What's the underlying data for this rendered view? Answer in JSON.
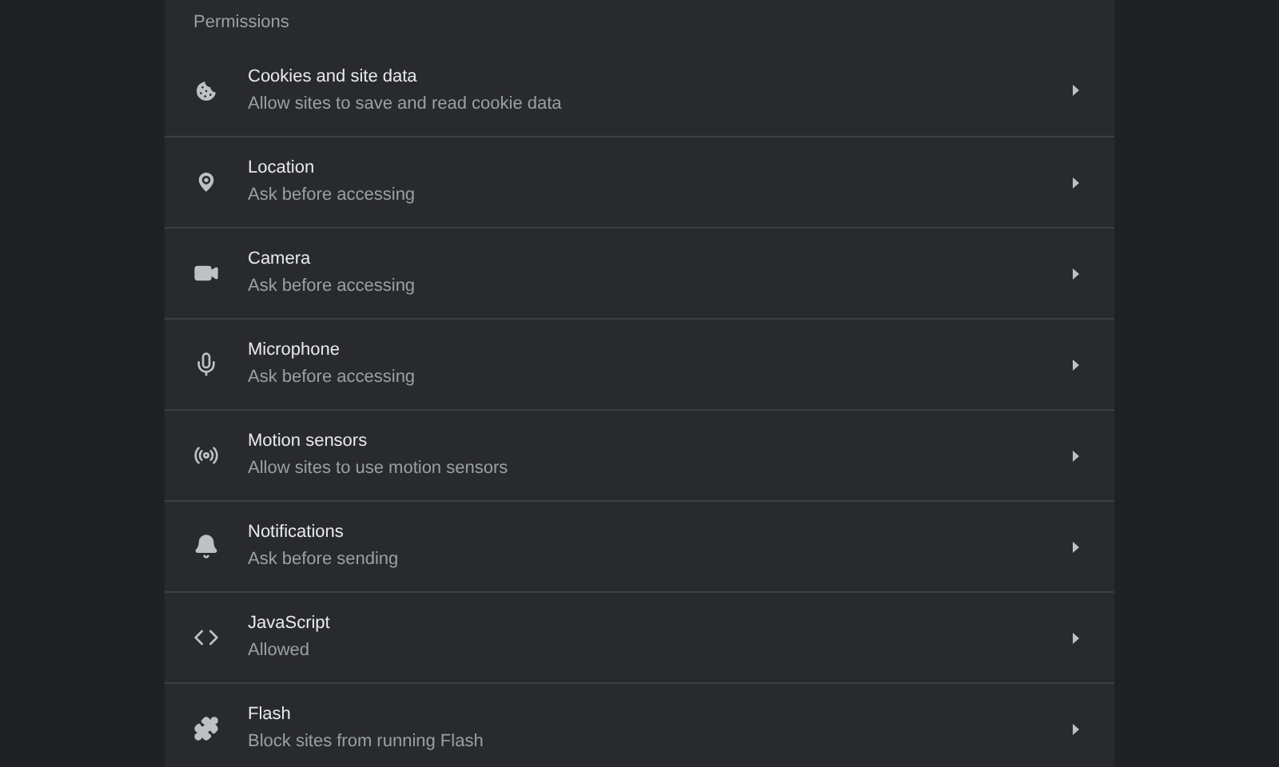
{
  "section_title": "Permissions",
  "items": [
    {
      "title": "Cookies and site data",
      "subtitle": "Allow sites to save and read cookie data"
    },
    {
      "title": "Location",
      "subtitle": "Ask before accessing"
    },
    {
      "title": "Camera",
      "subtitle": "Ask before accessing"
    },
    {
      "title": "Microphone",
      "subtitle": "Ask before accessing"
    },
    {
      "title": "Motion sensors",
      "subtitle": "Allow sites to use motion sensors"
    },
    {
      "title": "Notifications",
      "subtitle": "Ask before sending"
    },
    {
      "title": "JavaScript",
      "subtitle": "Allowed"
    },
    {
      "title": "Flash",
      "subtitle": "Block sites from running Flash"
    }
  ]
}
